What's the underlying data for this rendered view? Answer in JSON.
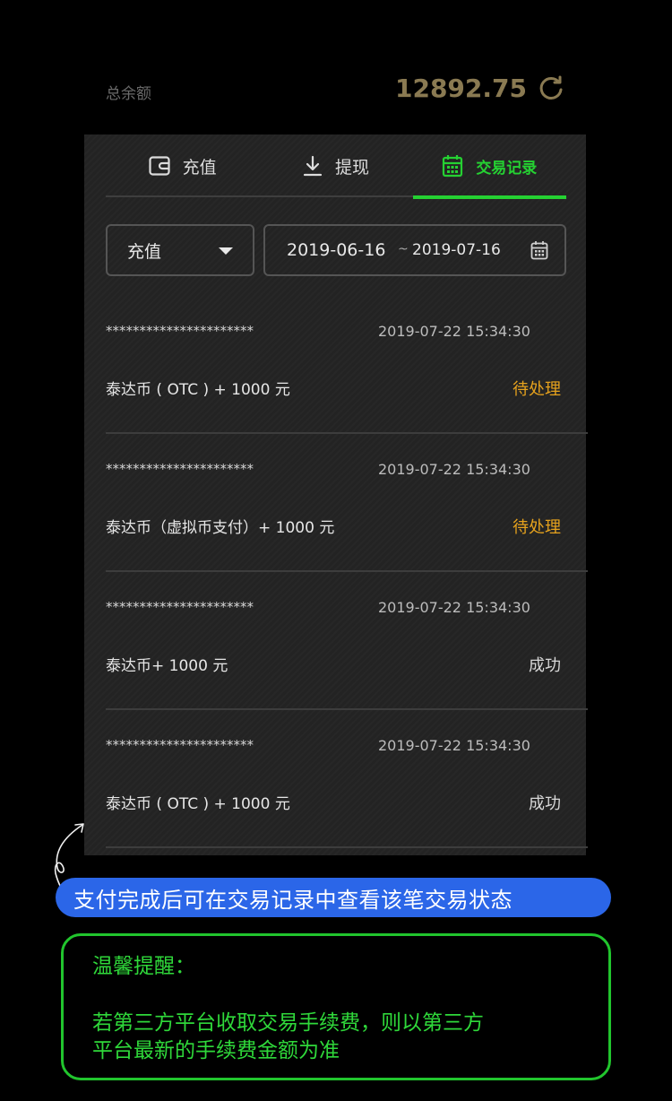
{
  "balance": {
    "label": "总余额",
    "value": "12892.75",
    "refresh_icon": "refresh-icon"
  },
  "tabs": [
    {
      "label": "充值",
      "icon": "wallet-icon",
      "active": false
    },
    {
      "label": "提现",
      "icon": "download-icon",
      "active": false
    },
    {
      "label": "交易记录",
      "icon": "calendar-icon",
      "active": true
    }
  ],
  "filter": {
    "type_value": "充值",
    "date_start": "2019-06-16",
    "date_separator": "~",
    "date_end": "2019-07-16"
  },
  "records": [
    {
      "account": "**********************",
      "time": "2019-07-22 15:34:30",
      "desc": "泰达币 ( OTC ) + 1000 元",
      "status": "待处理",
      "status_type": "pending"
    },
    {
      "account": "**********************",
      "time": "2019-07-22 15:34:30",
      "desc": "泰达币（虚拟币支付）+ 1000 元",
      "status": "待处理",
      "status_type": "pending"
    },
    {
      "account": "**********************",
      "time": "2019-07-22 15:34:30",
      "desc": "泰达币+ 1000 元",
      "status": "成功",
      "status_type": "success"
    },
    {
      "account": "**********************",
      "time": "2019-07-22 15:34:30",
      "desc": "泰达币 ( OTC ) + 1000 元",
      "status": "成功",
      "status_type": "success"
    }
  ],
  "tip": "支付完成后可在交易记录中查看该笔交易状态",
  "notice": {
    "title": "温馨提醒：",
    "body_line1": "若第三方平台收取交易手续费，则以第三方",
    "body_line2": "平台最新的手续费金额为准"
  },
  "colors": {
    "accent": "#25d132",
    "pending": "#e6a21d",
    "tip_bg": "#2b66e8",
    "balance": "#8a7a52"
  }
}
